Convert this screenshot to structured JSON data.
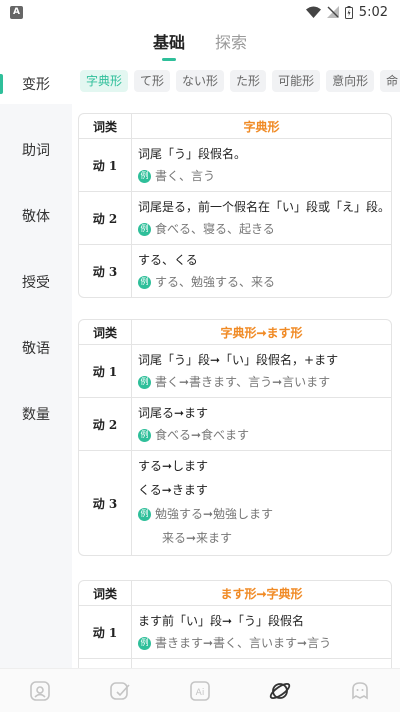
{
  "status": {
    "left_icon": "A",
    "time": "5:02"
  },
  "top_tabs": [
    {
      "label": "基础",
      "active": true
    },
    {
      "label": "探索",
      "active": false
    }
  ],
  "sidebar": {
    "items": [
      {
        "label": "变形",
        "active": true
      },
      {
        "label": "助词",
        "active": false
      },
      {
        "label": "敬体",
        "active": false
      },
      {
        "label": "授受",
        "active": false
      },
      {
        "label": "敬语",
        "active": false
      },
      {
        "label": "数量",
        "active": false
      }
    ]
  },
  "sub_tabs": [
    {
      "label": "字典形",
      "active": true
    },
    {
      "label": "て形",
      "active": false
    },
    {
      "label": "ない形",
      "active": false
    },
    {
      "label": "た形",
      "active": false
    },
    {
      "label": "可能形",
      "active": false
    },
    {
      "label": "意向形",
      "active": false
    },
    {
      "label": "命",
      "active": false
    }
  ],
  "tables": [
    {
      "key_header": "词类",
      "title": "字典形",
      "rows": [
        {
          "key": "动 1",
          "rule": "词尾「う」段假名。",
          "example": "書く、言う",
          "extra": ""
        },
        {
          "key": "动 2",
          "rule": "词尾是る，前一个假名在「い」段或「え」段。",
          "example": "食べる、寝る、起きる",
          "extra": ""
        },
        {
          "key": "动 3",
          "rule": "する、くる",
          "example": "する、勉強する、来る",
          "extra": ""
        }
      ]
    },
    {
      "key_header": "词类",
      "title": "字典形➞ます形",
      "rows": [
        {
          "key": "动 1",
          "rule": "词尾「う」段➞「い」段假名，+ます",
          "example": "書く➞書きます、言う➞言います",
          "extra": ""
        },
        {
          "key": "动 2",
          "rule": "词尾る➞ます",
          "example": "食べる➞食べます",
          "extra": ""
        },
        {
          "key": "动 3",
          "rule": "する➞します",
          "rule2": "くる➞きます",
          "example": "勉強する➞勉強します",
          "extra": "来る➞来ます"
        }
      ]
    },
    {
      "key_header": "词类",
      "title": "ます形➞字典形",
      "rows": [
        {
          "key": "动 1",
          "rule": "ます前「い」段➞「う」段假名",
          "example": "書きます➞書く、言います➞言う",
          "extra": ""
        },
        {
          "key": "动 2",
          "rule": "",
          "example": "",
          "extra": ""
        }
      ]
    }
  ],
  "example_badge": "例",
  "colors": {
    "accent": "#2fbf9a",
    "title_orange": "#f08a24"
  },
  "bottom_nav": {
    "items": [
      {
        "icon": "photo-icon"
      },
      {
        "icon": "edit-icon"
      },
      {
        "icon": "ai-icon",
        "label": "Ai"
      },
      {
        "icon": "planet-icon",
        "active": true
      },
      {
        "icon": "face-icon"
      }
    ]
  }
}
